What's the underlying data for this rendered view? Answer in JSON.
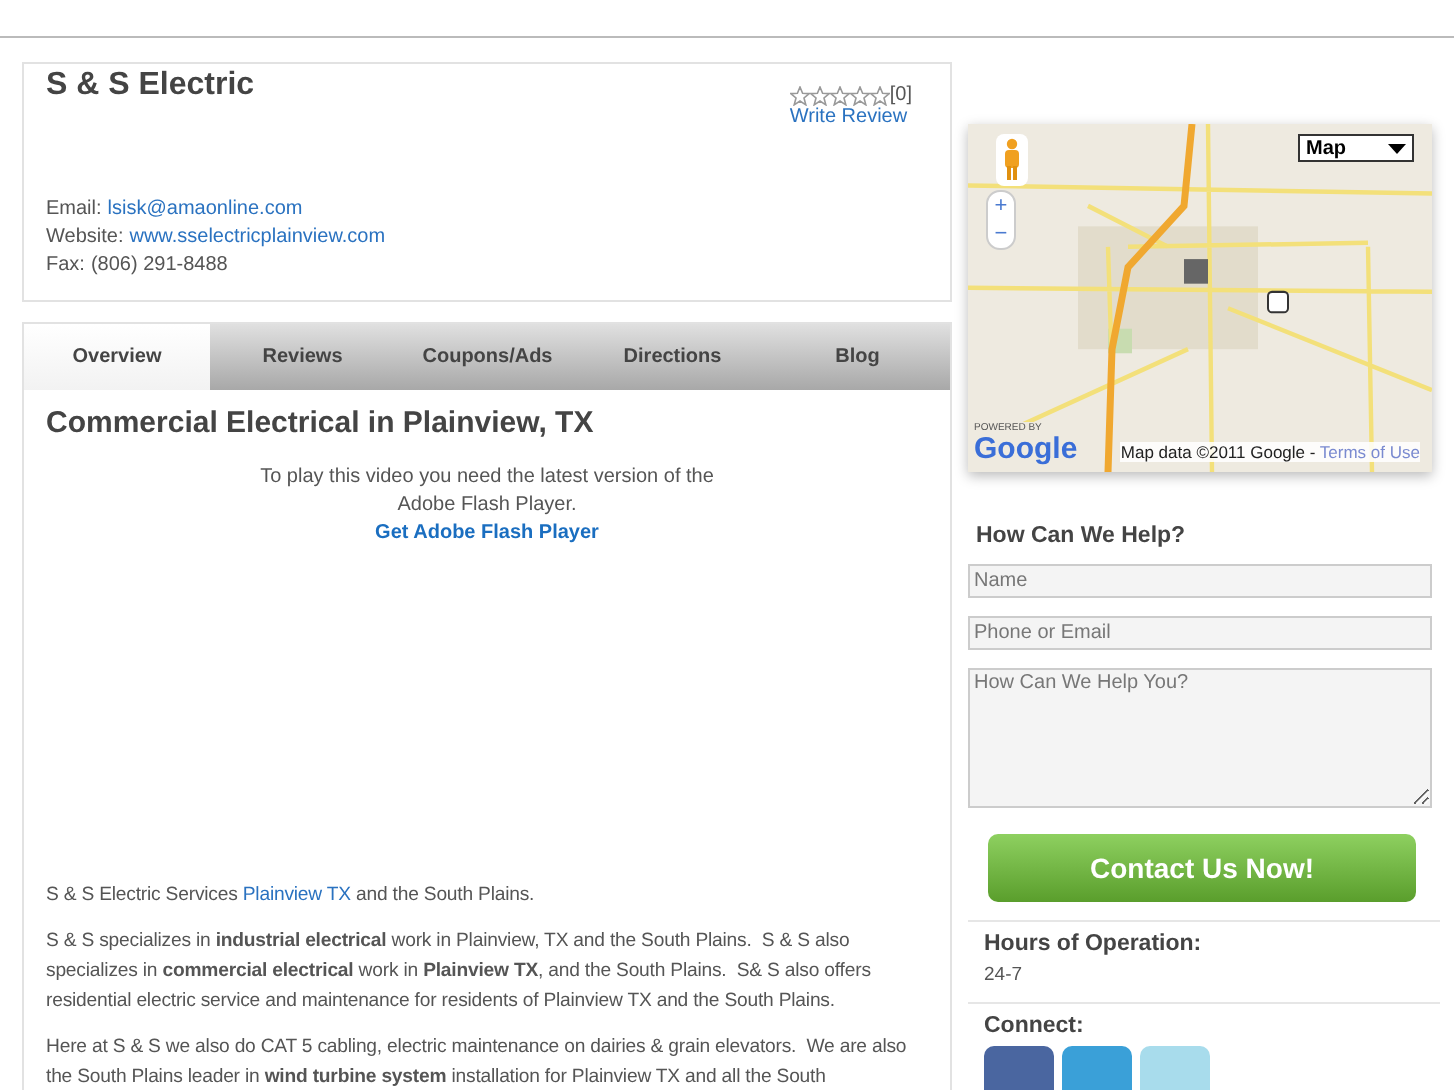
{
  "business": {
    "name": "S & S Electric",
    "stars": 0,
    "review_count": "[0]",
    "write_review": "Write Review",
    "contacts": [
      {
        "label": "Email:",
        "value": "lsisk@amaonline.com",
        "kind": "link"
      },
      {
        "label": "Website:",
        "value": "www.sselectricplainview.com",
        "kind": "link"
      },
      {
        "label": "Fax:",
        "value": "(806) 291-8488",
        "kind": "text"
      }
    ]
  },
  "tabs": [
    {
      "label": "Overview",
      "selected": true
    },
    {
      "label": "Reviews",
      "selected": false
    },
    {
      "label": "Coupons/Ads",
      "selected": false
    },
    {
      "label": "Directions",
      "selected": false
    },
    {
      "label": "Blog",
      "selected": false
    }
  ],
  "content": {
    "heading": "Commercial Electrical in Plainview, TX",
    "video_notice": "To play this video you need the latest version of the Adobe Flash Player.",
    "video_link": "Get Adobe Flash Player",
    "intro": {
      "before": "S & S Electric Services ",
      "link": "Plainview TX",
      "after": " and the South Plains."
    },
    "paragraphs": [
      "S & S specializes in **industrial electrical** work in Plainview, TX and the South Plains.  S & S also specializes in **commercial electrical** work in **Plainview TX**, and the South Plains.  S& S also offers residential electric service and maintenance for residents of Plainview TX and the South Plains.",
      "Here at S & S we also do CAT 5 cabling, electric maintenance on dairies & grain elevators.  We are also the South Plains leader in **wind turbine system** installation for Plainview TX and all the South"
    ]
  },
  "map": {
    "type_select": "Map",
    "zoom_in": "+",
    "zoom_out": "−",
    "powered_by": "POWERED BY",
    "logo": "Google",
    "attribution": "Map data ©2011 Google - ",
    "terms": "Terms of Use"
  },
  "form": {
    "title": "How Can We Help?",
    "fields": [
      {
        "placeholder": "Name",
        "kind": "input"
      },
      {
        "placeholder": "Phone or Email",
        "kind": "input"
      },
      {
        "placeholder": "How Can We Help You?",
        "kind": "textarea"
      }
    ],
    "button": "Contact Us Now!"
  },
  "hours": {
    "title": "Hours of Operation:",
    "value": "24-7"
  },
  "connect": {
    "title": "Connect:",
    "icons": [
      {
        "color": "#4a66a0"
      },
      {
        "color": "#3aa0d8"
      },
      {
        "color": "#a8dcec"
      }
    ]
  }
}
